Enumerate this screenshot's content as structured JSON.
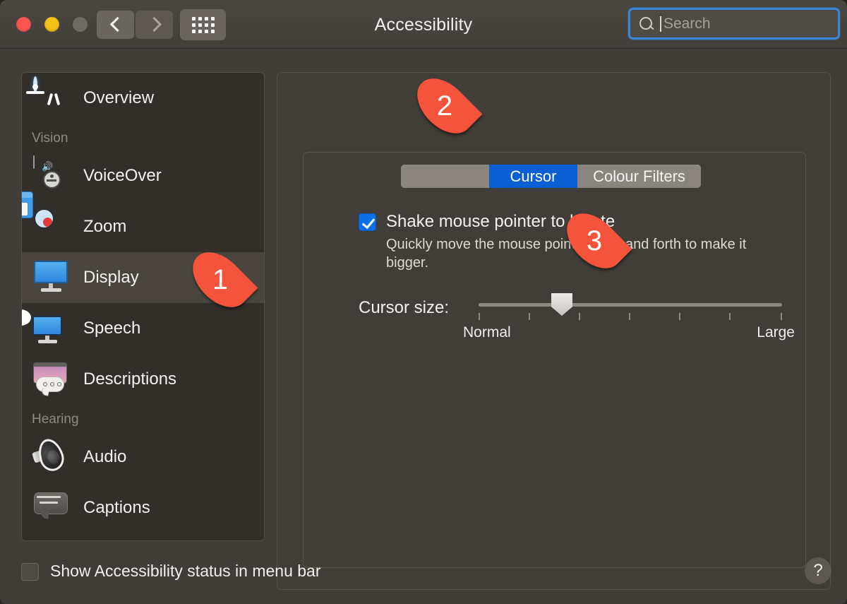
{
  "window": {
    "title": "Accessibility",
    "traffic_lights": [
      "close",
      "minimise",
      "zoom-disabled"
    ],
    "nav": {
      "back_icon": "chevron-left-icon",
      "forward_icon": "chevron-right-icon",
      "grid_icon": "show-all-grid-icon"
    }
  },
  "search": {
    "placeholder": "Search",
    "value": "",
    "icon": "search-icon",
    "focused": true
  },
  "sidebar": {
    "items": [
      {
        "label": "Overview",
        "icon": "accessibility-person-icon",
        "selected": false,
        "group": null
      },
      {
        "label": "VoiceOver",
        "icon": "voiceover-icon",
        "selected": false,
        "group": "Vision"
      },
      {
        "label": "Zoom",
        "icon": "zoom-magnifier-icon",
        "selected": false,
        "group": "Vision"
      },
      {
        "label": "Display",
        "icon": "display-monitor-icon",
        "selected": true,
        "group": "Vision"
      },
      {
        "label": "Speech",
        "icon": "speech-bubble-icon",
        "selected": false,
        "group": "Vision"
      },
      {
        "label": "Descriptions",
        "icon": "descriptions-icon",
        "selected": false,
        "group": "Vision"
      },
      {
        "label": "Audio",
        "icon": "speaker-cone-icon",
        "selected": false,
        "group": "Hearing"
      },
      {
        "label": "Captions",
        "icon": "captions-icon",
        "selected": false,
        "group": "Hearing"
      }
    ],
    "group_headers": {
      "vision": "Vision",
      "hearing": "Hearing"
    }
  },
  "main": {
    "tabs": [
      {
        "label": "",
        "active": false
      },
      {
        "label": "Cursor",
        "active": true
      },
      {
        "label": "Colour Filters",
        "active": false
      }
    ],
    "shake_setting": {
      "label": "Shake mouse pointer to locate",
      "description": "Quickly move the mouse pointer back and forth to make it bigger.",
      "checked": true
    },
    "cursor_size": {
      "label": "Cursor size:",
      "min_label": "Normal",
      "max_label": "Large",
      "value_percent": 27,
      "tick_count": 7
    }
  },
  "bottom": {
    "status_checkbox": {
      "label": "Show Accessibility status in menu bar",
      "checked": false
    },
    "help_label": "?"
  },
  "markers": [
    {
      "number": "1",
      "target": "sidebar-item-display"
    },
    {
      "number": "2",
      "target": "tab-cursor"
    },
    {
      "number": "3",
      "target": "cursor-size-slider"
    }
  ],
  "colors": {
    "accent_blue": "#0b5fd4",
    "marker_red": "#f4543c",
    "focus_ring": "#3a86d4",
    "window_bg": "#413d38",
    "sidebar_bg": "#322f2b"
  }
}
